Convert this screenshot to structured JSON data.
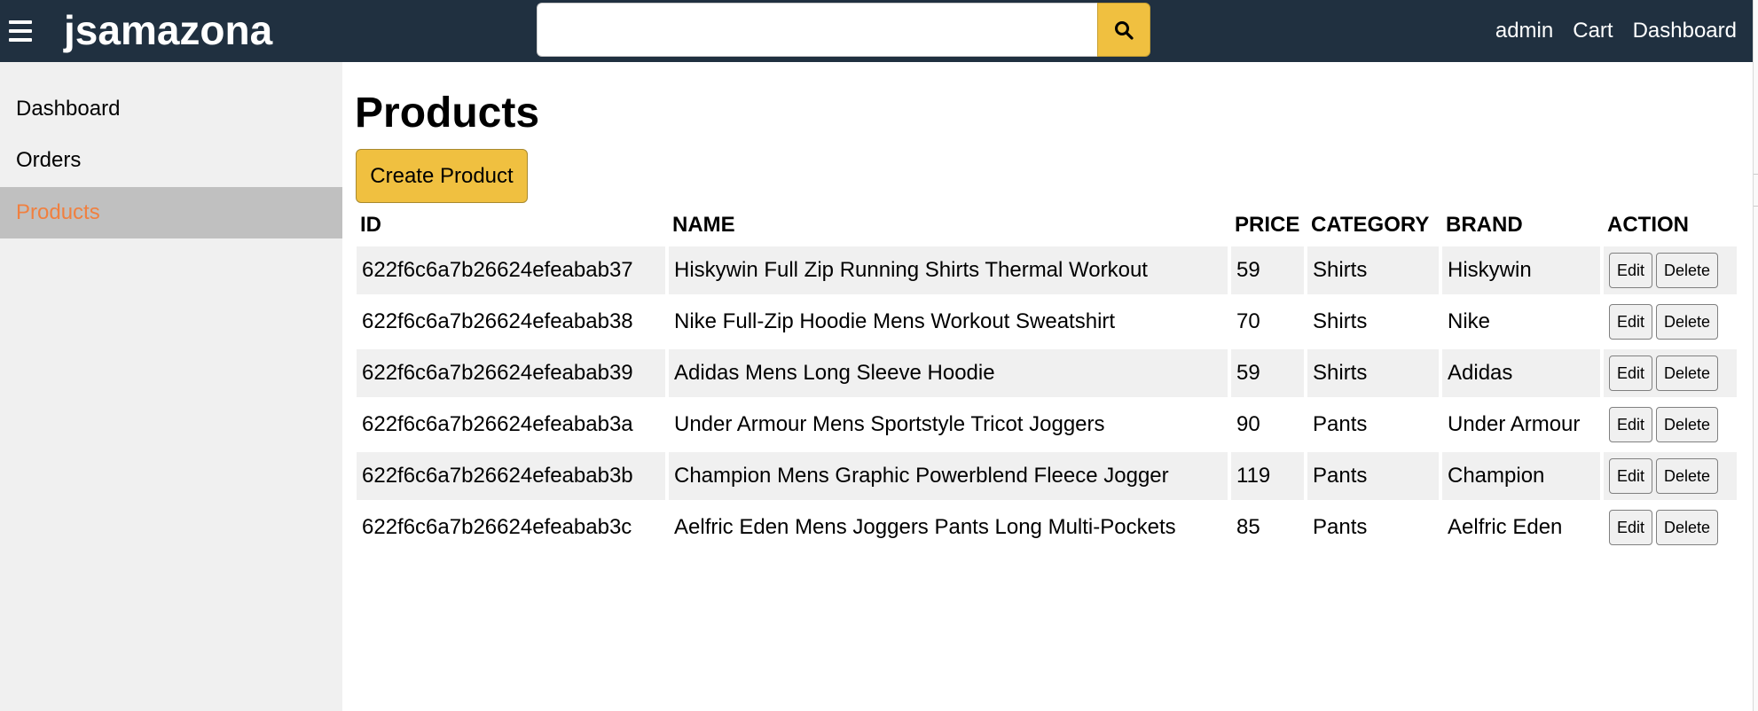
{
  "header": {
    "brand": "jsamazona",
    "search": {
      "value": "",
      "placeholder": ""
    },
    "links": [
      "admin",
      "Cart",
      "Dashboard"
    ]
  },
  "sidebar": {
    "items": [
      {
        "label": "Dashboard",
        "active": false
      },
      {
        "label": "Orders",
        "active": false
      },
      {
        "label": "Products",
        "active": true
      }
    ]
  },
  "main": {
    "title": "Products",
    "create_label": "Create Product",
    "table": {
      "headers": [
        "ID",
        "NAME",
        "PRICE",
        "CATEGORY",
        "BRAND",
        "ACTION"
      ],
      "edit_label": "Edit",
      "delete_label": "Delete",
      "rows": [
        [
          "622f6c6a7b26624efeabab37",
          "Hiskywin Full Zip Running Shirts Thermal Workout",
          "59",
          "Shirts",
          "Hiskywin"
        ],
        [
          "622f6c6a7b26624efeabab38",
          "Nike Full-Zip Hoodie Mens Workout Sweatshirt",
          "70",
          "Shirts",
          "Nike"
        ],
        [
          "622f6c6a7b26624efeabab39",
          "Adidas Mens Long Sleeve Hoodie",
          "59",
          "Shirts",
          "Adidas"
        ],
        [
          "622f6c6a7b26624efeabab3a",
          "Under Armour Mens Sportstyle Tricot Joggers",
          "90",
          "Pants",
          "Under Armour"
        ],
        [
          "622f6c6a7b26624efeabab3b",
          "Champion Mens Graphic Powerblend Fleece Jogger",
          "119",
          "Pants",
          "Champion"
        ],
        [
          "622f6c6a7b26624efeabab3c",
          "Aelfric Eden Mens Joggers Pants Long Multi-Pockets",
          "85",
          "Pants",
          "Aelfric Eden"
        ]
      ]
    }
  },
  "colors": {
    "header_bg": "#203040",
    "accent": "#f0c040",
    "active_link": "#f08040",
    "sidebar_bg": "#f0f0f0",
    "active_item_bg": "#c0c0c0"
  },
  "icons": {
    "menu": "hamburger-icon",
    "search": "search-icon"
  }
}
